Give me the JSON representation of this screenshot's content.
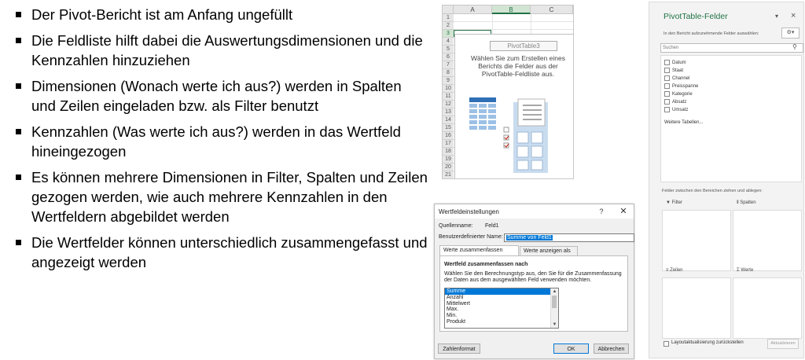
{
  "slide": {
    "bullets": [
      "Der Pivot-Bericht ist am Anfang ungefüllt",
      "Die Feldliste hilft dabei die Auswertungsdimensionen und die Kennzahlen hinzuziehen",
      "Dimensionen (Wonach werte ich aus?) werden in Spalten und Zeilen eingeladen bzw. als Filter benutzt",
      "Kennzahlen (Was werte ich aus?) werden in das Wertfeld hineingezogen",
      "Es können mehrere Dimensionen in Filter, Spalten und Zeilen gezogen werden, wie auch mehrere Kennzahlen in den Wertfeldern abgebildet werden",
      "Die Wertfelder können unterschiedlich zusammengefasst und angezeigt werden"
    ]
  },
  "excel": {
    "columns": [
      "A",
      "B",
      "C"
    ],
    "rows": [
      "1",
      "2",
      "3",
      "4",
      "5",
      "6",
      "7",
      "8",
      "9",
      "10",
      "11",
      "12",
      "13",
      "14",
      "15",
      "16",
      "17",
      "18",
      "19",
      "20",
      "21"
    ],
    "pivot_name": "PivotTable3",
    "pivot_prompt": "Wählen Sie zum Erstellen eines Berichts die Felder aus der PivotTable-Feldliste aus.",
    "accent_color": "#217346"
  },
  "dialog": {
    "title": "Wertfeldeinstellungen",
    "help": "?",
    "close": "✕",
    "source_label": "Quellenname:",
    "source_value": "Feld1",
    "custom_name_label": "Benutzerdefinierter Name:",
    "custom_name_value": "Summe von Feld1",
    "tabs": [
      "Werte zusammenfassen nach",
      "Werte anzeigen als"
    ],
    "section_title": "Wertfeld zusammenfassen nach",
    "section_desc": "Wählen Sie den Berechnungstyp aus, den Sie für die Zusammenfassung der Daten aus dem ausgewählten Feld verwenden möchten.",
    "functions": [
      "Summe",
      "Anzahl",
      "Mittelwert",
      "Max.",
      "Min.",
      "Produkt"
    ],
    "selected_function": "Summe",
    "number_format_button": "Zahlenformat",
    "ok_button": "OK",
    "cancel_button": "Abbrechen"
  },
  "panel": {
    "title": "PivotTable-Felder",
    "subtitle": "In den Bericht aufzunehmende Felder auswählen:",
    "search_placeholder": "Suchen",
    "fields": [
      "Datum",
      "Staat",
      "Channel",
      "Preisspanne",
      "Kategorie",
      "Absatz",
      "Umsatz"
    ],
    "more_tables": "Weitere Tabellen...",
    "areas_hint": "Felder zwischen den Bereichen ziehen und ablegen:",
    "areas": {
      "filter": "Filter",
      "columns": "Spalten",
      "rows": "Zeilen",
      "values": "Werte"
    },
    "defer_label": "Layoutaktualisierung zurückstellen",
    "update_button": "Aktualisieren",
    "title_color": "#217346"
  }
}
